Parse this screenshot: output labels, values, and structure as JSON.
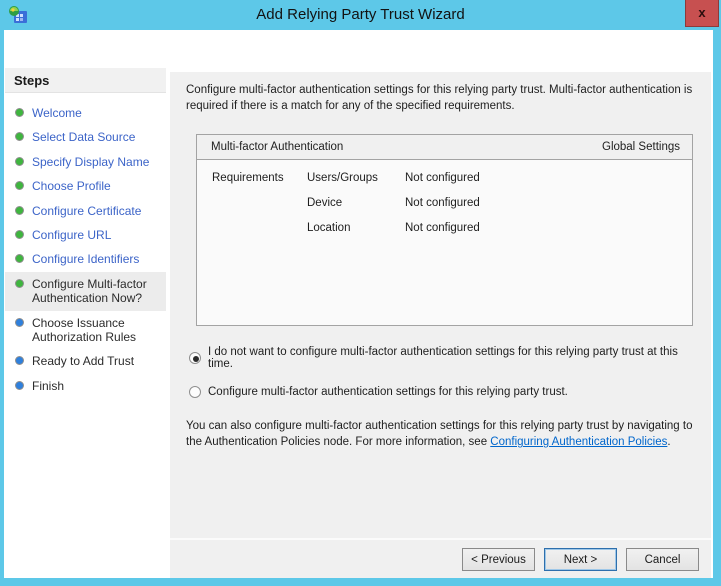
{
  "window": {
    "title": "Add Relying Party Trust Wizard",
    "close_label": "x"
  },
  "colors": {
    "frame": "#5dc8e8",
    "close": "#c75050",
    "link": "#0066cc",
    "step_done": "#3c64c8",
    "dot_green": "#3fb53f",
    "dot_blue": "#2f80dc"
  },
  "sidebar": {
    "header": "Steps",
    "items": [
      {
        "label": "Welcome",
        "status": "completed"
      },
      {
        "label": "Select Data Source",
        "status": "completed"
      },
      {
        "label": "Specify Display Name",
        "status": "completed"
      },
      {
        "label": "Choose Profile",
        "status": "completed"
      },
      {
        "label": "Configure Certificate",
        "status": "completed"
      },
      {
        "label": "Configure URL",
        "status": "completed"
      },
      {
        "label": "Configure Identifiers",
        "status": "completed"
      },
      {
        "label": "Configure Multi-factor Authentication Now?",
        "status": "current"
      },
      {
        "label": "Choose Issuance Authorization Rules",
        "status": "pending"
      },
      {
        "label": "Ready to Add Trust",
        "status": "pending"
      },
      {
        "label": "Finish",
        "status": "pending"
      }
    ]
  },
  "main": {
    "intro": "Configure multi-factor authentication settings for this relying party trust. Multi-factor authentication is required if there is a match for any of the specified requirements.",
    "table": {
      "header_left": "Multi-factor Authentication",
      "header_right": "Global Settings",
      "rows": [
        {
          "group": "Requirements",
          "name": "Users/Groups",
          "value": "Not configured"
        },
        {
          "group": "",
          "name": "Device",
          "value": "Not configured"
        },
        {
          "group": "",
          "name": "Location",
          "value": "Not configured"
        }
      ]
    },
    "radios": [
      {
        "label": "I do not want to configure multi-factor authentication settings for this relying party trust at this time.",
        "selected": true
      },
      {
        "label": "Configure multi-factor authentication settings for this relying party trust.",
        "selected": false
      }
    ],
    "note": {
      "text_before_link": "You can also configure multi-factor authentication settings for this relying party trust by navigating to the Authentication Policies node. For more information, see ",
      "link": "Configuring Authentication Policies",
      "text_after_link": "."
    },
    "buttons": [
      "< Previous",
      "Next >",
      "Cancel"
    ]
  }
}
